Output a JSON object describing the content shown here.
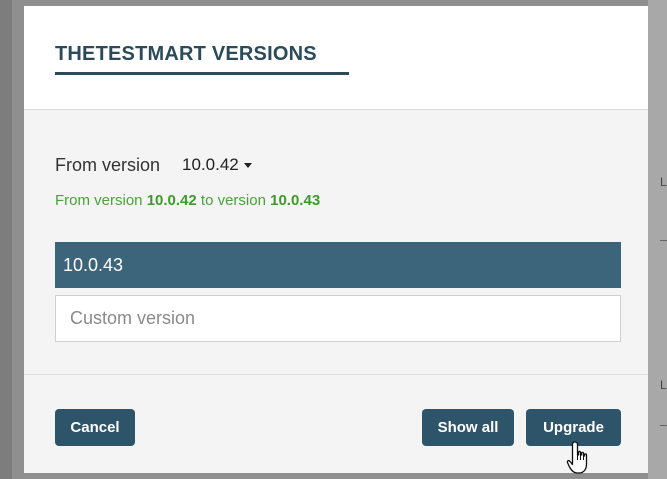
{
  "background": {
    "hint_text": "L"
  },
  "dialog": {
    "title": "THETESTMART VERSIONS",
    "from_label": "From version",
    "from_value": "10.0.42",
    "summary": {
      "prefix": "From version ",
      "from": "10.0.42",
      "middle": " to version ",
      "to": "10.0.43"
    },
    "selected_version": "10.0.43",
    "custom_placeholder": "Custom version",
    "custom_value": ""
  },
  "buttons": {
    "cancel": "Cancel",
    "show_all": "Show all",
    "upgrade": "Upgrade"
  },
  "colors": {
    "accent": "#2e5469",
    "selected_row": "#3c657c",
    "summary_green": "#4aa23a"
  },
  "icons": {
    "cursor": "hand-pointer-icon",
    "caret": "caret-down-icon"
  }
}
